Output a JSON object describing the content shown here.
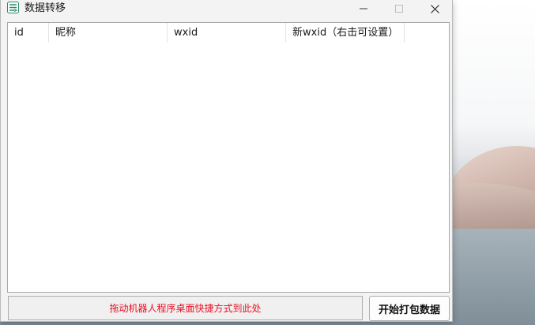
{
  "window": {
    "title": "数据转移"
  },
  "table": {
    "columns": [
      "id",
      "昵称",
      "wxid",
      "新wxid（右击可设置）"
    ],
    "rows": []
  },
  "footer": {
    "dropzone_text": "拖动机器人程序桌面快捷方式到此处",
    "pack_button": "开始打包数据"
  },
  "colors": {
    "dropzone_text": "#e81123",
    "window_bg": "#f3f3f3"
  }
}
